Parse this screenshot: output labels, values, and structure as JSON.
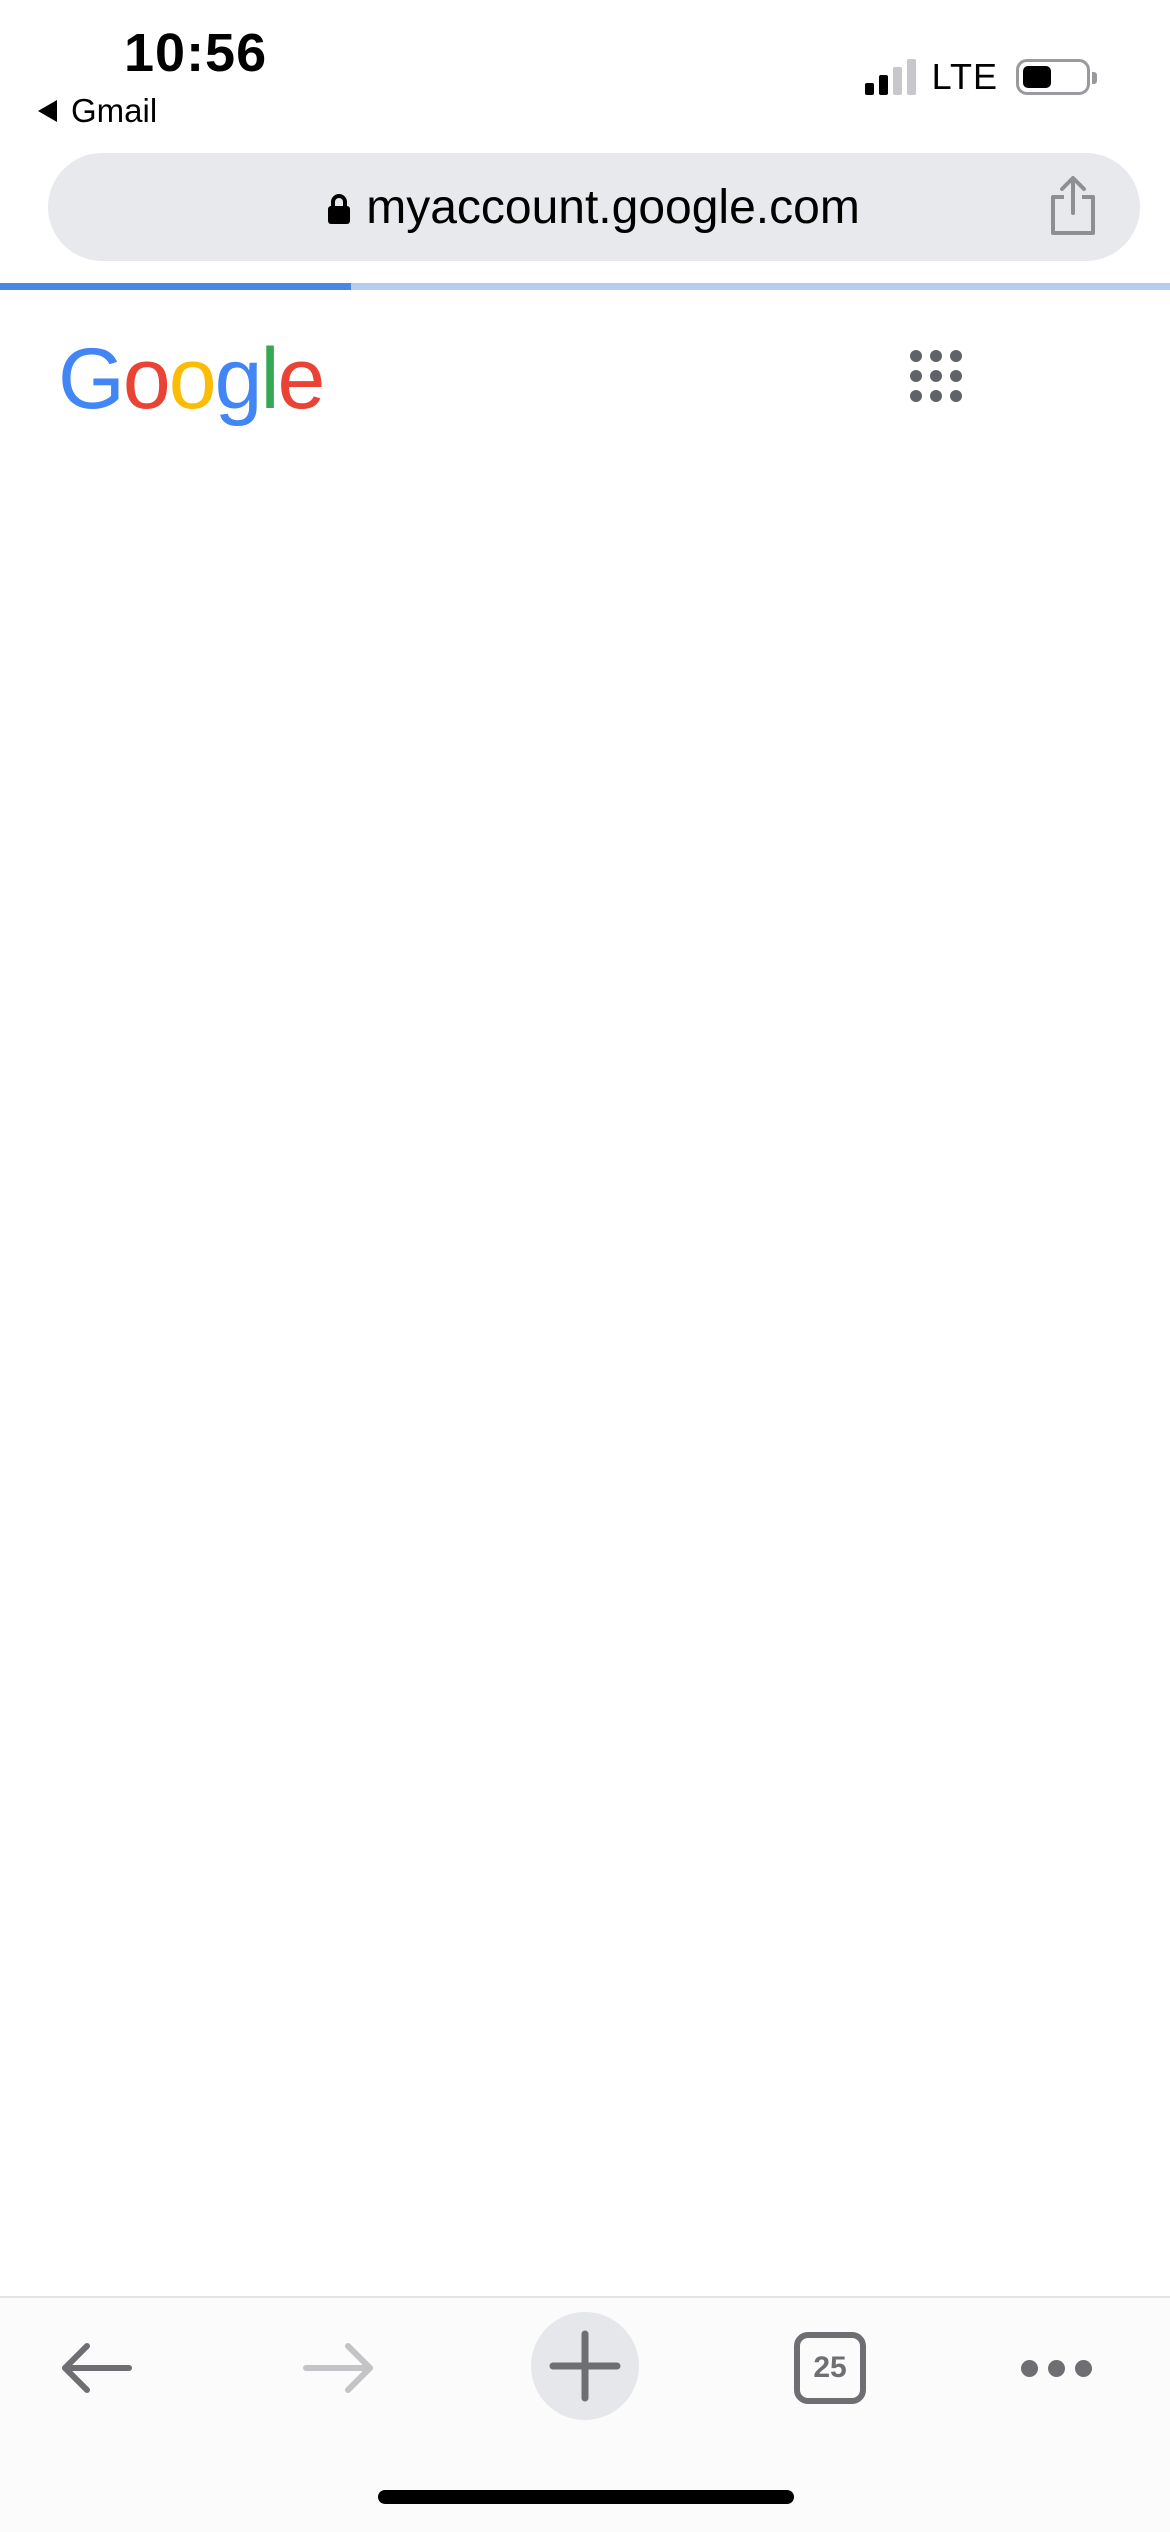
{
  "status_bar": {
    "time": "10:56",
    "back_app": "Gmail",
    "network": "LTE",
    "signal_bars_active": 2,
    "signal_bars_total": 4,
    "battery_level": 0.45
  },
  "address_bar": {
    "url": "myaccount.google.com",
    "lock_icon": "lock-icon",
    "share_icon": "share-icon"
  },
  "progress": {
    "fraction": 0.3
  },
  "page": {
    "logo_letters": [
      {
        "char": "G",
        "color": "#4285F4"
      },
      {
        "char": "o",
        "color": "#EA4335"
      },
      {
        "char": "o",
        "color": "#FBBC05"
      },
      {
        "char": "g",
        "color": "#4285F4"
      },
      {
        "char": "l",
        "color": "#34A853"
      },
      {
        "char": "e",
        "color": "#EA4335"
      }
    ],
    "apps_icon": "apps-grid-icon"
  },
  "toolbar": {
    "back_icon": "arrow-left-icon",
    "forward_icon": "arrow-right-icon",
    "new_tab_icon": "plus-icon",
    "tab_count": "25",
    "more_icon": "more-horizontal-icon"
  },
  "colors": {
    "accent": "#4A87E5",
    "progress_track": "#B5CDF0",
    "address_bg": "#E8E9EC",
    "toolbar_icon": "#6F6F73"
  }
}
